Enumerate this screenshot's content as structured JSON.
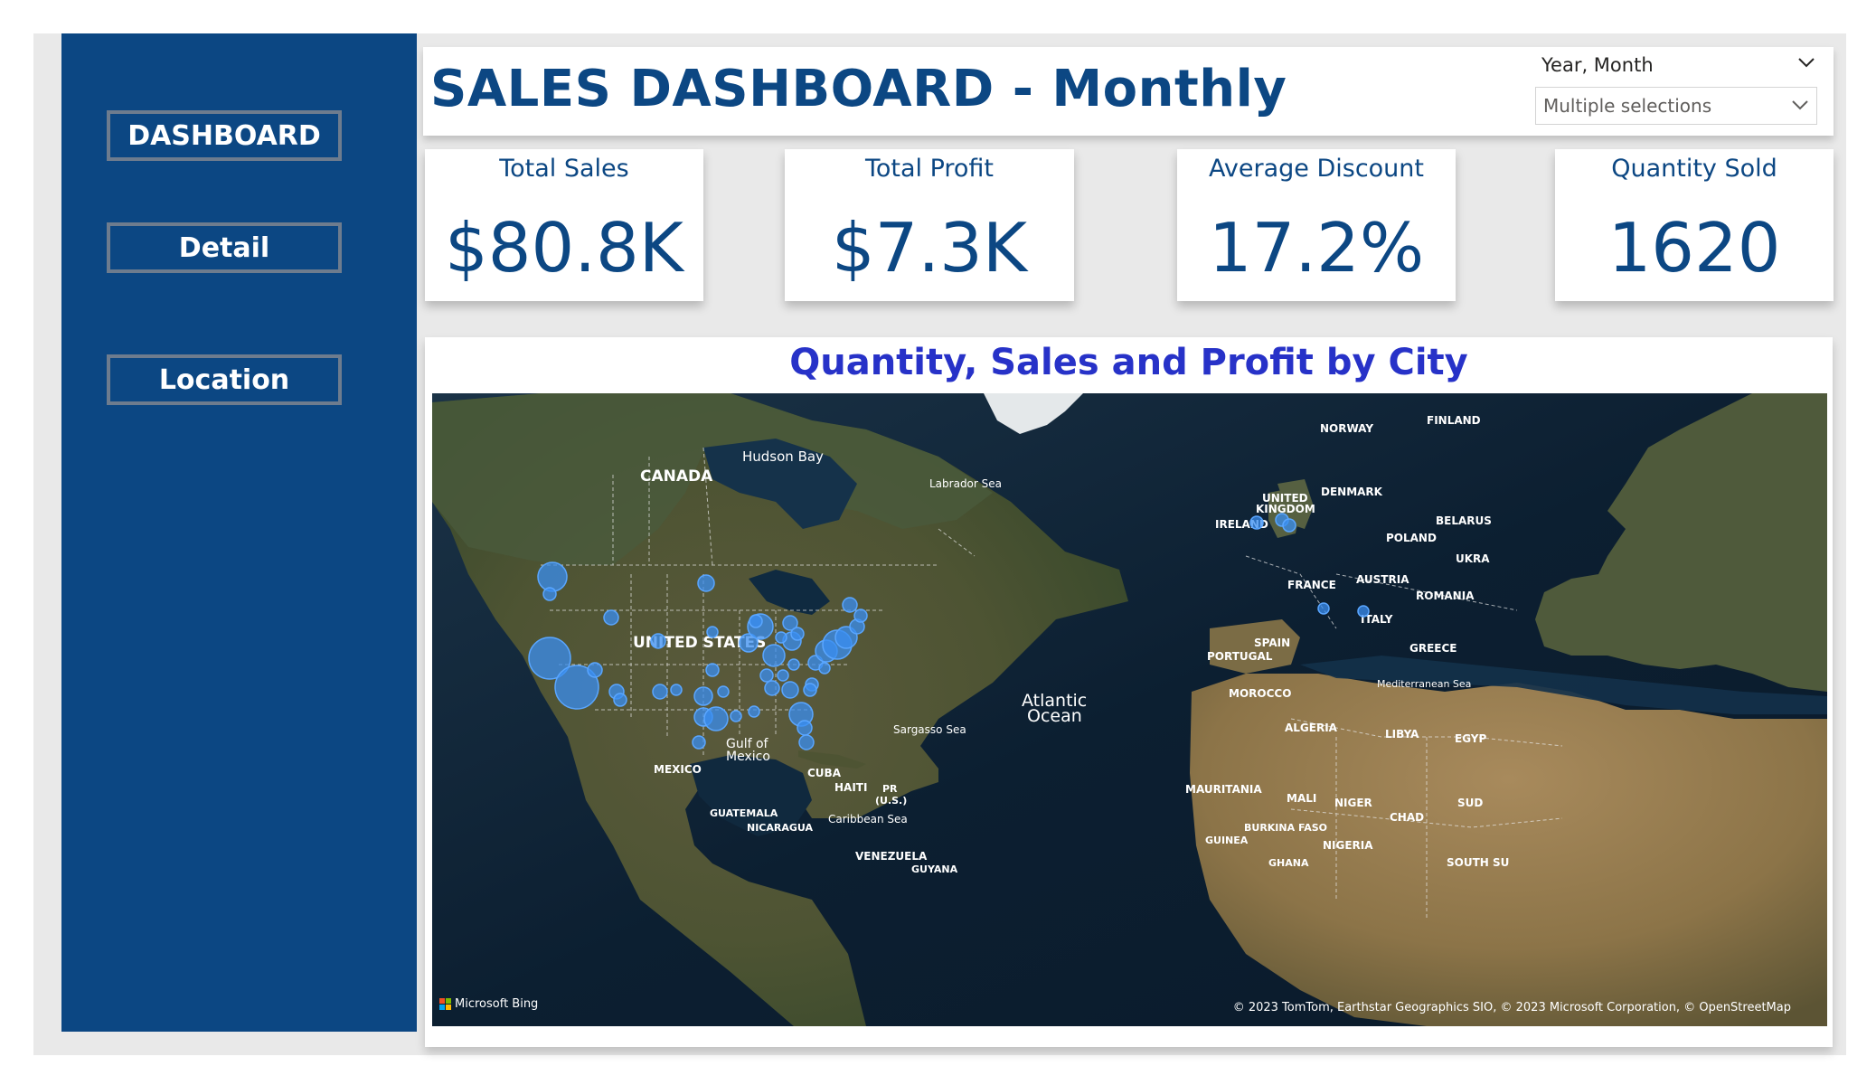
{
  "nav": {
    "items": [
      {
        "label": "DASHBOARD"
      },
      {
        "label": "Detail"
      },
      {
        "label": "Location"
      }
    ]
  },
  "header": {
    "title": "SALES DASHBOARD - Monthly",
    "slicer": {
      "label": "Year, Month",
      "value": "Multiple selections"
    }
  },
  "kpis": [
    {
      "label": "Total Sales",
      "value": "$80.8K"
    },
    {
      "label": "Total Profit",
      "value": "$7.3K"
    },
    {
      "label": "Average Discount",
      "value": "17.2%"
    },
    {
      "label": "Quantity Sold",
      "value": "1620"
    }
  ],
  "map": {
    "title": "Quantity, Sales and Profit by City",
    "labels": {
      "canada": "CANADA",
      "hudson_bay": "Hudson Bay",
      "labrador_sea": "Labrador Sea",
      "united_states": "UNITED STATES",
      "mexico": "MEXICO",
      "gulf1": "Gulf of",
      "gulf2": "Mexico",
      "cuba": "CUBA",
      "haiti": "HAITI",
      "pr1": "PR",
      "pr2": "(U.S.)",
      "guatemala": "GUATEMALA",
      "nicaragua": "NICARAGUA",
      "caribbean": "Caribbean Sea",
      "venezuela": "VENEZUELA",
      "sargasso": "Sargasso Sea",
      "atlantic1": "Atlantic",
      "atlantic2": "Ocean",
      "norway": "NORWAY",
      "finland": "FINLAND",
      "uk1": "UNITED",
      "uk2": "KINGDOM",
      "ireland": "IRELAND",
      "denmark": "DENMARK",
      "belarus": "BELARUS",
      "poland": "POLAND",
      "ukraine": "UKRA",
      "france": "FRANCE",
      "austria": "AUSTRIA",
      "romania": "ROMANIA",
      "italy": "ITALY",
      "spain": "SPAIN",
      "portugal": "PORTUGAL",
      "greece": "GREECE",
      "morocco": "MOROCCO",
      "mediterranean": "Mediterranean Sea",
      "algeria": "ALGERIA",
      "libya": "LIBYA",
      "egypt": "EGYP",
      "mauritania": "MAURITANIA",
      "mali": "MALI",
      "niger": "NIGER",
      "chad": "CHAD",
      "sudan": "SUD",
      "burkina": "BURKINA FASO",
      "guinea": "GUINEA",
      "nigeria": "NIGERIA",
      "ghana": "GHANA",
      "south_sudan": "SOUTH SU",
      "guyana": "GUYANA"
    },
    "logo_text": "Microsoft Bing",
    "copyright": "© 2023 TomTom, Earthstar Geographics SIO, © 2023 Microsoft Corporation, © OpenStreetMap"
  },
  "colors": {
    "sidebar": "#0c4783",
    "title_text": "#0c4783",
    "map_title": "#2732c8",
    "bubble": "#3a8df0"
  },
  "icons": {
    "slicer_header": "chevron-down-icon",
    "slicer_dropdown": "chevron-down-icon"
  }
}
